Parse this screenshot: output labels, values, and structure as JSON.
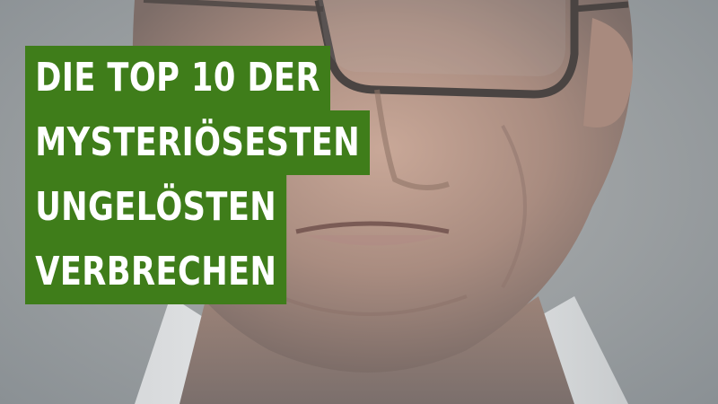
{
  "title": {
    "lines": [
      "DIE TOP 10 DER",
      "MYSTERIÖSESTEN",
      "UNGELÖSTEN",
      "VERBRECHEN"
    ]
  },
  "colors": {
    "banner": "#3f7d1a",
    "text": "#ffffff",
    "background": "#9aa0a3"
  }
}
